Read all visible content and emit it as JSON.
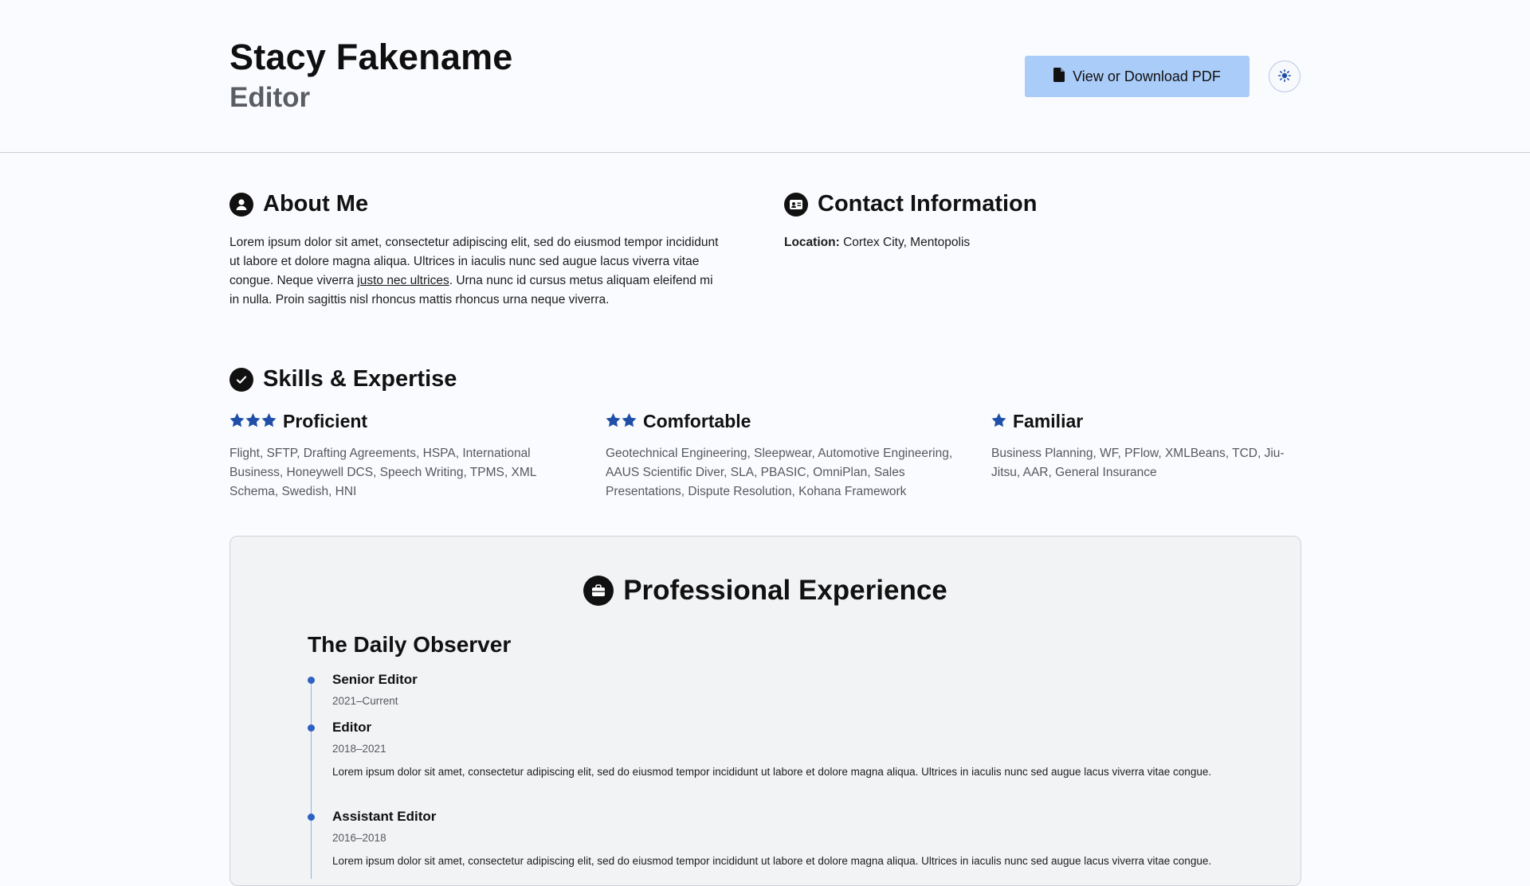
{
  "header": {
    "name": "Stacy Fakename",
    "role": "Editor",
    "pdf_button_label": "View or Download PDF",
    "pdf_icon": "file-icon",
    "theme_icon": "sun-icon"
  },
  "about": {
    "title": "About Me",
    "icon": "user-circle-icon",
    "text_before_link": "Lorem ipsum dolor sit amet, consectetur adipiscing elit, sed do eiusmod tempor incididunt ut labore et dolore magna aliqua. Ultrices in iaculis nunc sed augue lacus viverra vitae congue. Neque viverra ",
    "link_text": "justo nec ultrices",
    "text_after_link": ". Urna nunc id cursus metus aliquam eleifend mi in nulla. Proin sagittis nisl rhoncus mattis rhoncus urna neque viverra."
  },
  "contact": {
    "title": "Contact Information",
    "icon": "address-card-icon",
    "location_label": "Location:",
    "location_value": "Cortex City, Mentopolis"
  },
  "skills": {
    "title": "Skills & Expertise",
    "icon": "check-circle-icon",
    "star_color": "#1f4fa8",
    "groups": [
      {
        "label": "Proficient",
        "stars": 3,
        "items": "Flight, SFTP, Drafting Agreements, HSPA, International Business, Honeywell DCS, Speech Writing, TPMS, XML Schema, Swedish, HNI"
      },
      {
        "label": "Comfortable",
        "stars": 2,
        "items": "Geotechnical Engineering, Sleepwear, Automotive Engineering, AAUS Scientific Diver, SLA, PBASIC, OmniPlan, Sales Presentations, Dispute Resolution, Kohana Framework"
      },
      {
        "label": "Familiar",
        "stars": 1,
        "items": "Business Planning, WF, PFlow, XMLBeans, TCD, Jiu-Jitsu, AAR, General Insurance"
      }
    ]
  },
  "experience": {
    "title": "Professional Experience",
    "icon": "briefcase-circle-icon",
    "company": "The Daily Observer",
    "timeline_color": "#2d61c2",
    "jobs": [
      {
        "title": "Senior Editor",
        "dates": "2021–Current",
        "description": ""
      },
      {
        "title": "Editor",
        "dates": "2018–2021",
        "description": "Lorem ipsum dolor sit amet, consectetur adipiscing elit, sed do eiusmod tempor incididunt ut labore et dolore magna aliqua. Ultrices in iaculis nunc sed augue lacus viverra vitae congue."
      },
      {
        "title": "Assistant Editor",
        "dates": "2016–2018",
        "description": "Lorem ipsum dolor sit amet, consectetur adipiscing elit, sed do eiusmod tempor incididunt ut labore et dolore magna aliqua. Ultrices in iaculis nunc sed augue lacus viverra vitae congue."
      }
    ]
  }
}
